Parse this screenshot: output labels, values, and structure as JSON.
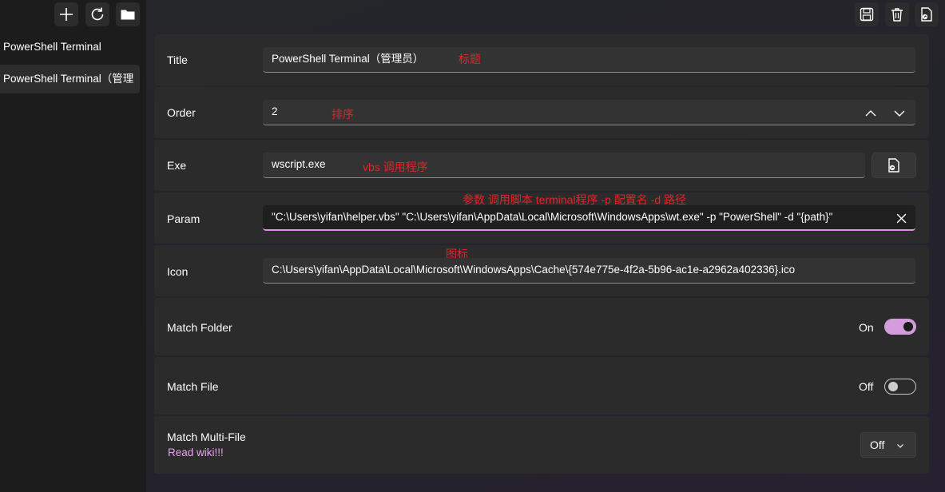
{
  "toolbar": {
    "add_icon": "plus-icon",
    "refresh_icon": "refresh-icon",
    "folder_icon": "folder-icon",
    "save_icon": "save-icon",
    "delete_icon": "trash-icon",
    "open_file_icon": "file-open-icon"
  },
  "sidebar": {
    "items": [
      {
        "label": "PowerShell Terminal"
      },
      {
        "label": "PowerShell Terminal（管理"
      }
    ]
  },
  "form": {
    "title": {
      "label": "Title",
      "value": "PowerShell Terminal（管理员）",
      "annotation": "标题"
    },
    "order": {
      "label": "Order",
      "value": "2",
      "annotation": "排序"
    },
    "exe": {
      "label": "Exe",
      "value": "wscript.exe",
      "annotation": "vbs 调用程序"
    },
    "param": {
      "label": "Param",
      "value": "\"C:\\Users\\yifan\\helper.vbs\" \"C:\\Users\\yifan\\AppData\\Local\\Microsoft\\WindowsApps\\wt.exe\" -p \"PowerShell\" -d \"{path}\"",
      "annotation": "参数 调用脚本 terminal程序 -p 配置名 -d 路径"
    },
    "icon": {
      "label": "Icon",
      "value": "C:\\Users\\yifan\\AppData\\Local\\Microsoft\\WindowsApps\\Cache\\{574e775e-4f2a-5b96-ac1e-a2962a402336}.ico",
      "annotation": "图标"
    },
    "match_folder": {
      "label": "Match Folder",
      "state": "On"
    },
    "match_file": {
      "label": "Match File",
      "state": "Off"
    },
    "match_multi": {
      "label": "Match Multi-File",
      "link": "Read wiki!!!",
      "value": "Off"
    }
  },
  "colors": {
    "accent": "#d39ddb",
    "annotation": "#e0252a",
    "link": "#e7a3ee"
  }
}
